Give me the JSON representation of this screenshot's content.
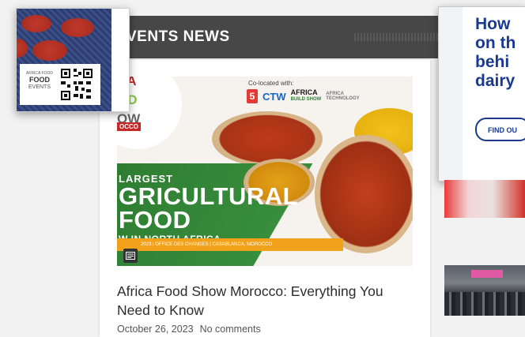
{
  "section": {
    "title": "VENTS NEWS"
  },
  "popup": {
    "logo_top": "AFRICA FOOD",
    "logo_main": "FOOD",
    "logo_bottom": "EVENTS",
    "qr_icon": "qr-code-icon"
  },
  "banner": {
    "colocated_label": "Co-located with:",
    "logo_5": "5",
    "logo_ctw": "CTW",
    "logo_africa": "AFRICA",
    "logo_build": "BUILD SHOW",
    "logo_tech": "AFRICA TECHNOLOGY",
    "circle_line1": "CA",
    "circle_line2": "OD",
    "circle_line3": "OW",
    "morocco_tag": "OCCO",
    "line1": "LARGEST",
    "line2": "GRICULTURAL",
    "line3": "FOOD",
    "line4": "W IN NORTH AFRICA",
    "strip_text": "2023 | OFFICE DES CHANGES | CASABLANCA, MOROCCO",
    "format_icon": "newspaper-icon"
  },
  "article": {
    "title": "Africa Food Show Morocco: Everything You Need to Know",
    "date": "October 26, 2023",
    "comments": "No comments"
  },
  "ad": {
    "headline": "How\non th\nbehi\ndairy",
    "button": "FIND OU"
  },
  "colors": {
    "header_bg": "#474747",
    "ad_accent": "#1a3a8f",
    "banner_green": "#2e7d32",
    "banner_orange": "#f2a21a",
    "brand_red": "#c62828"
  }
}
